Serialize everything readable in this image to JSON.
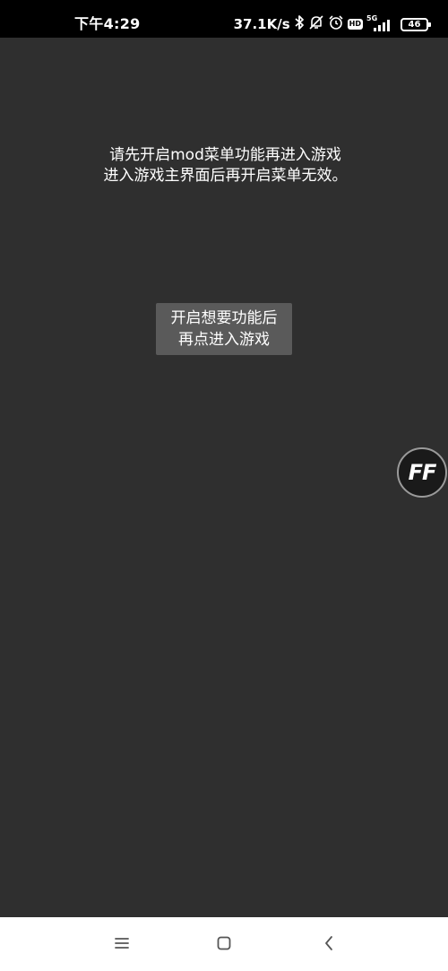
{
  "status_bar": {
    "time": "下午4:29",
    "net_speed": "37.1K/s",
    "hd_badge": "HD",
    "network_type": "5G",
    "battery": "46",
    "icons": [
      "bluetooth-icon",
      "mute-icon",
      "alarm-icon",
      "hd-icon",
      "signal-icon",
      "battery-icon"
    ]
  },
  "main": {
    "message_line1": "请先开启mod菜单功能再进入游戏",
    "message_line2": "进入游戏主界面后再开启菜单无效。",
    "enter_button_line1": "开启想要功能后",
    "enter_button_line2": "再点进入游戏",
    "floating_button_label": "FF"
  },
  "nav_bar": {
    "icons": [
      "menu-icon",
      "home-square-icon",
      "back-chevron-icon"
    ]
  },
  "colors": {
    "background": "#2f2f2f",
    "status_bar": "#000000",
    "button": "#5a5a5a",
    "nav_bar": "#ffffff"
  }
}
